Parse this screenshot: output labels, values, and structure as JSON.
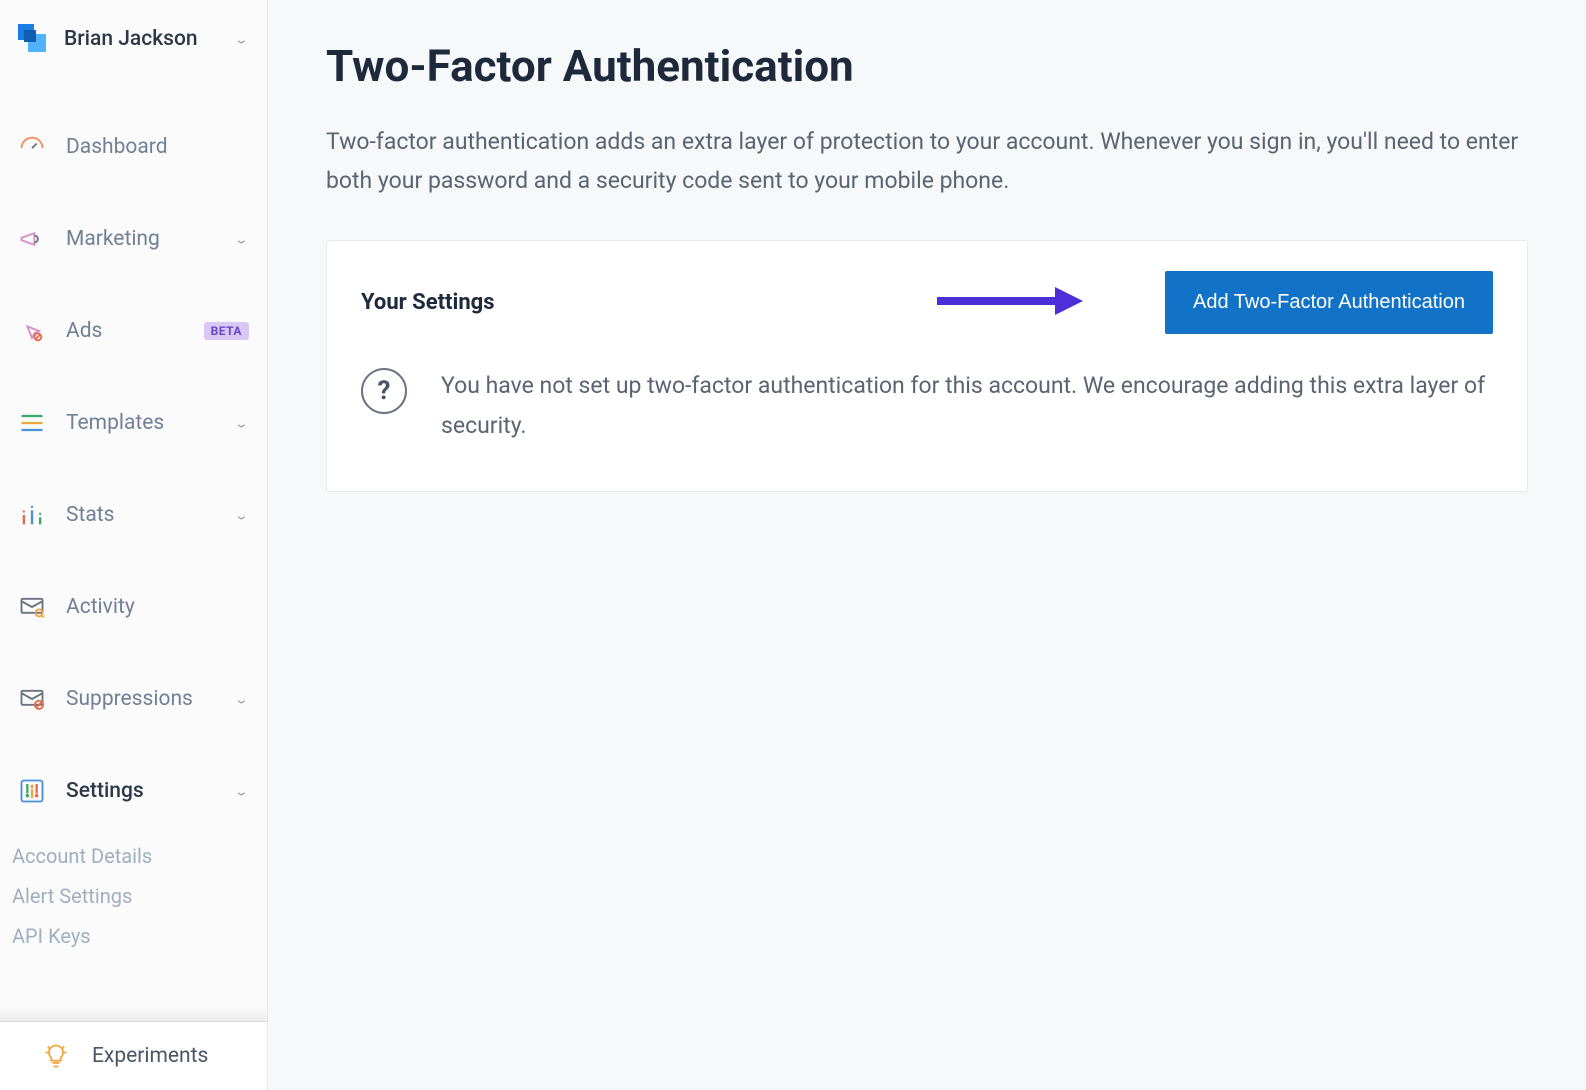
{
  "user": {
    "name": "Brian Jackson"
  },
  "sidebar": {
    "items": [
      {
        "label": "Dashboard",
        "expandable": false
      },
      {
        "label": "Marketing",
        "expandable": true
      },
      {
        "label": "Ads",
        "expandable": false,
        "badge": "BETA"
      },
      {
        "label": "Templates",
        "expandable": true
      },
      {
        "label": "Stats",
        "expandable": true
      },
      {
        "label": "Activity",
        "expandable": false
      },
      {
        "label": "Suppressions",
        "expandable": true
      },
      {
        "label": "Settings",
        "expandable": true,
        "active": true
      }
    ],
    "settings_sub": [
      "Account Details",
      "Alert Settings",
      "API Keys"
    ],
    "bottom": {
      "label": "Experiments"
    }
  },
  "page": {
    "title": "Two-Factor Authentication",
    "description": "Two-factor authentication adds an extra layer of protection to your account. Whenever you sign in, you'll need to enter both your password and a security code sent to your mobile phone."
  },
  "card": {
    "title": "Your Settings",
    "button": "Add Two-Factor Authentication",
    "info_glyph": "?",
    "info_text": "You have not set up two-factor authentication for this account. We encourage adding this extra layer of security."
  }
}
